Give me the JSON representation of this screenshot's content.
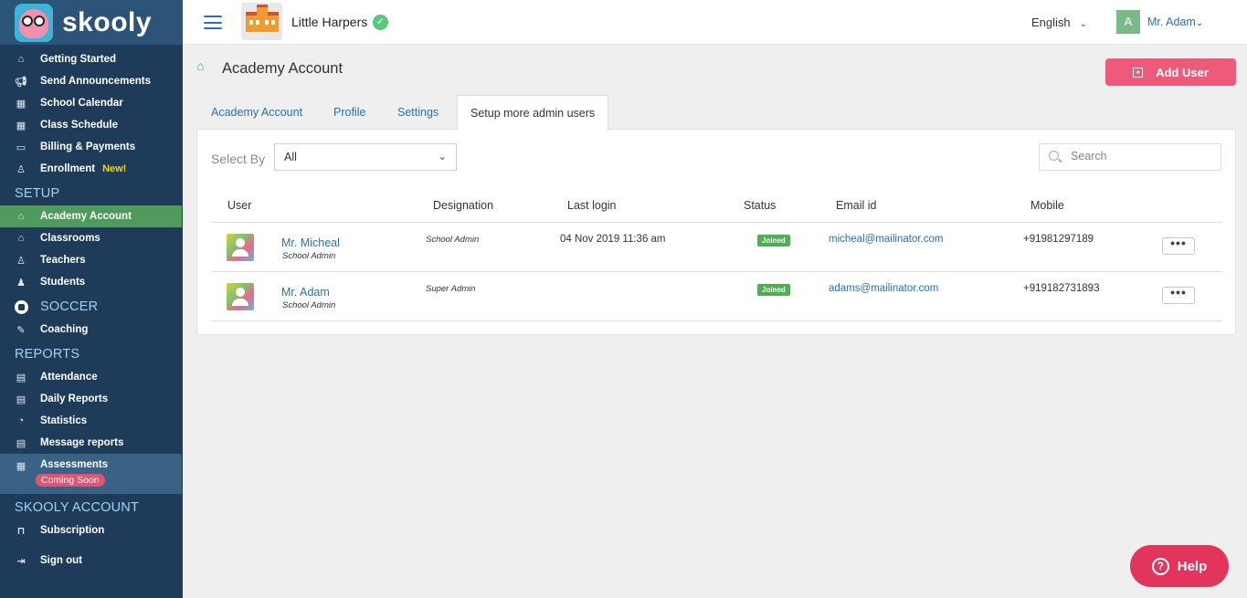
{
  "brand": {
    "name": "skooly"
  },
  "sidebar": {
    "items": [
      {
        "label": "Getting Started",
        "icon": "home-icon"
      },
      {
        "label": "Send Announcements",
        "icon": "megaphone-icon"
      },
      {
        "label": "School Calendar",
        "icon": "calendar-icon"
      },
      {
        "label": "Class Schedule",
        "icon": "calendar-icon"
      },
      {
        "label": "Billing & Payments",
        "icon": "card-icon"
      },
      {
        "label": "Enrollment",
        "icon": "user-plus-icon",
        "badge": "New!"
      }
    ],
    "setup_heading": "SETUP",
    "setup_items": [
      {
        "label": "Academy Account",
        "icon": "school-icon",
        "active": true
      },
      {
        "label": "Classrooms",
        "icon": "classroom-icon"
      },
      {
        "label": "Teachers",
        "icon": "teacher-icon"
      },
      {
        "label": "Students",
        "icon": "student-icon"
      }
    ],
    "soccer_heading": "SOCCER",
    "soccer_items": [
      {
        "label": "Coaching",
        "icon": "whistle-icon"
      }
    ],
    "reports_heading": "REPORTS",
    "reports_items": [
      {
        "label": "Attendance",
        "icon": "report-icon"
      },
      {
        "label": "Daily Reports",
        "icon": "report-icon"
      },
      {
        "label": "Statistics",
        "icon": "pie-icon"
      },
      {
        "label": "Message reports",
        "icon": "report-icon"
      },
      {
        "label": "Assessments",
        "icon": "calendar-icon",
        "badge": "Coming Soon"
      }
    ],
    "account_heading": "SKOOLY ACCOUNT",
    "account_items": [
      {
        "label": "Subscription",
        "icon": "bookmark-icon"
      },
      {
        "label": "Sign out",
        "icon": "signout-icon"
      }
    ]
  },
  "topbar": {
    "school_name": "Little Harpers",
    "language": "English",
    "user_initial": "A",
    "user_name": "Mr. Adam"
  },
  "page": {
    "title": "Academy Account",
    "add_user_label": "Add User"
  },
  "tabs": [
    {
      "label": "Academy Account"
    },
    {
      "label": "Profile"
    },
    {
      "label": "Settings"
    },
    {
      "label": "Setup more admin users",
      "active": true
    }
  ],
  "filters": {
    "select_by_label": "Select By",
    "select_value": "All",
    "search_placeholder": "Search"
  },
  "table": {
    "headers": [
      "User",
      "Designation",
      "Last login",
      "Status",
      "Email id",
      "Mobile"
    ],
    "rows": [
      {
        "name": "Mr. Micheal",
        "role": "School Admin",
        "designation": "School Admin",
        "last_login": "04 Nov 2019 11:36 am",
        "status": "Joined",
        "email": "micheal@mailinator.com",
        "mobile": "+91981297189",
        "more": "•••"
      },
      {
        "name": "Mr. Adam",
        "role": "School Admin",
        "designation": "Super Admin",
        "last_login": "",
        "status": "Joined",
        "email": "adams@mailinator.com",
        "mobile": "+919182731893",
        "more": "•••"
      }
    ]
  },
  "help": {
    "label": "Help"
  },
  "colors": {
    "sidebar_bg": "#1f3b5a",
    "active_green": "#4e9b5b",
    "accent_pink": "#ee5a7a",
    "link_blue": "#2a6fb8",
    "status_green": "#4caf50"
  }
}
